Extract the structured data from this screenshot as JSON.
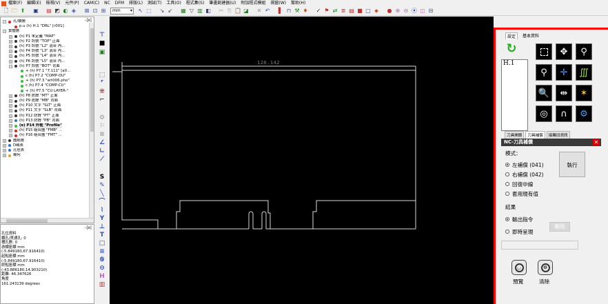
{
  "menubar": {
    "items": [
      "檔案(F)",
      "編輯(E)",
      "檢視(V)",
      "元件(P)",
      "CAM(C)",
      "NC",
      "DFM",
      "排版(L)",
      "測試(T)",
      "工具(O)",
      "程式集(S)",
      "筆畫創建器(U)",
      "附加程式模組",
      "視窗(W)",
      "幫助(H)"
    ]
  },
  "toolbar": {
    "units_value": "mm"
  },
  "tree": {
    "close_label": "-|x|",
    "rows": [
      {
        "indent": 0,
        "exp": "⊟",
        "color": "#e02020",
        "label": "孔/鑽層"
      },
      {
        "indent": 1,
        "exp": "",
        "color": "#e02020",
        "label": "p.u (h) H.1 \"DRL\" [r001]"
      },
      {
        "indent": 0,
        "exp": "⊟",
        "color": "",
        "label": "實體層"
      },
      {
        "indent": 1,
        "exp": "⊞",
        "color": "#303030",
        "label": "(h) P1 未定義 \"MAP\""
      },
      {
        "indent": 1,
        "exp": "⊞",
        "color": "#303030",
        "label": "(h) P2 訊號 \"TOP\" 正面"
      },
      {
        "indent": 1,
        "exp": "⊞",
        "color": "#303030",
        "label": "(h) P3 訊號 \"L2\" 混合 內..."
      },
      {
        "indent": 1,
        "exp": "⊞",
        "color": "#303030",
        "label": "(h) P4 訊號 \"L3\" 混合 內..."
      },
      {
        "indent": 1,
        "exp": "⊞",
        "color": "#303030",
        "label": "(h) P5 訊號 \"L4\" 混合 內..."
      },
      {
        "indent": 1,
        "exp": "⊞",
        "color": "#303030",
        "label": "(h) P6 訊號 \"L5\" 混合 內..."
      },
      {
        "indent": 1,
        "exp": "⊟",
        "color": "#303030",
        "label": "(h) P7 訊號 \"BOT\" 背面"
      },
      {
        "indent": 2,
        "exp": "",
        "color": "#30c030",
        "label": "+ (h) P7.1 \"7.111\" [a0..."
      },
      {
        "indent": 2,
        "exp": "",
        "color": "#30c030",
        "label": "c (h) P7.2 \"COMP-OU\""
      },
      {
        "indent": 2,
        "exp": "",
        "color": "#30c030",
        "label": "+ (h) P7.3 \"art006.pho\""
      },
      {
        "indent": 2,
        "exp": "",
        "color": "#30c030",
        "label": "c (h) P7.4 \"COMP-CU\""
      },
      {
        "indent": 2,
        "exp": "",
        "color": "#30c030",
        "label": "+ (h) P7.5 \"CU LAYER-\""
      },
      {
        "indent": 1,
        "exp": "⊞",
        "color": "#303030",
        "label": "(h) P8 防銲 \"MT\" 正面"
      },
      {
        "indent": 1,
        "exp": "⊞",
        "color": "#303030",
        "label": "(h) P9 防銲 \"MB\" 背面"
      },
      {
        "indent": 1,
        "exp": "⊞",
        "color": "#303030",
        "label": "(h) P10 文字 \"SLT\" 正面"
      },
      {
        "indent": 1,
        "exp": "⊞",
        "color": "#303030",
        "label": "(h) P11 文字 \"SLB\" 背面"
      },
      {
        "indent": 1,
        "exp": "⊞",
        "color": "#303030",
        "label": "(h) P12 防銲 \"PT\" 正面"
      },
      {
        "indent": 1,
        "exp": "⊞",
        "color": "#3070d0",
        "label": "(h) P13 防銲 \"PB\" 背面"
      },
      {
        "indent": 1,
        "exp": "⊞",
        "color": "#30c030",
        "label": "(e) P14 外框 \"Profile\"",
        "selected": true
      },
      {
        "indent": 1,
        "exp": "⊞",
        "color": "#e02020",
        "label": "(h) P15 組合圖 \"FMB\" ..."
      },
      {
        "indent": 1,
        "exp": "⊞",
        "color": "#e02020",
        "label": "(h) P16 組合圖 \"FMT\" ..."
      },
      {
        "indent": 0,
        "exp": "⊞",
        "color": "#303030",
        "label": "圖紙層"
      },
      {
        "indent": 0,
        "exp": "⊞",
        "color": "#3070d0",
        "label": "D碼表"
      },
      {
        "indent": 0,
        "exp": "⊞",
        "color": "#3070d0",
        "label": "孔徑表"
      },
      {
        "indent": 0,
        "exp": "⊞",
        "color": "#e0a020",
        "label": "幾何"
      }
    ]
  },
  "info": {
    "close_label": "-|x|",
    "lines": [
      "孔位資料",
      "鑽孔/貫通孔: 0",
      "槽孔數: 0",
      "",
      "游標座標 mm",
      "(-5.849180,67.916410)",
      "起點座標 mm",
      "(-5.849180,67.916410)",
      "終點座標 mm",
      "(-43.886180,14.903210)",
      "距離: 46.347626",
      "角度",
      "161.243139 degrees"
    ]
  },
  "canvas": {
    "dimension_text": "120.142"
  },
  "right_panel": {
    "tabs": [
      "設定",
      "基本資料"
    ],
    "tool_list_item": "H.1",
    "tool_tabs": [
      "刀具開關",
      "刀具補償",
      "接觸旧資訊"
    ],
    "header_title": "NC-刀具補償",
    "mode_label": "模式：",
    "mode_options": [
      {
        "label": "左補償 (041)",
        "checked": true
      },
      {
        "label": "右補償 (042)",
        "checked": false
      },
      {
        "label": "回復中線",
        "checked": false
      },
      {
        "label": "套用現有值",
        "checked": false
      }
    ],
    "execute_label": "執行",
    "result_label": "結果",
    "result_options": [
      {
        "label": "輸出指令",
        "checked": true
      },
      {
        "label": "即時呈現",
        "checked": false
      }
    ],
    "disabled_button_label": "刪除",
    "preview_label": "預覽",
    "clear_label": "清除"
  },
  "colors": {
    "accent_red": "#ff0000",
    "canvas_bg": "#000000",
    "outline": "#d8d8d8"
  }
}
